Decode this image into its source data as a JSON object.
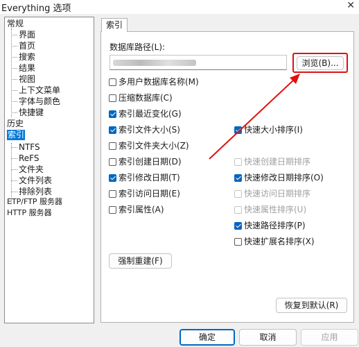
{
  "window": {
    "title": "Everything 选项",
    "close_glyph": "✕"
  },
  "tree": {
    "items": [
      {
        "label": "常规"
      },
      {
        "label": "界面"
      },
      {
        "label": "首页"
      },
      {
        "label": "搜索"
      },
      {
        "label": "结果"
      },
      {
        "label": "视图"
      },
      {
        "label": "上下文菜单"
      },
      {
        "label": "字体与颜色"
      },
      {
        "label": "快捷键"
      },
      {
        "label": "历史"
      },
      {
        "label": "索引",
        "selected": true
      },
      {
        "label": "NTFS"
      },
      {
        "label": "ReFS"
      },
      {
        "label": "文件夹"
      },
      {
        "label": "文件列表"
      },
      {
        "label": "排除列表"
      },
      {
        "label": "ETP/FTP 服务器"
      },
      {
        "label": "HTTP 服务器"
      }
    ]
  },
  "tab": {
    "label": "索引"
  },
  "db_path": {
    "label": "数据库路径(L):",
    "value": "",
    "browse_label": "浏览(B)..."
  },
  "options_left": [
    {
      "label": "多用户数据库名称(M)",
      "checked": false
    },
    {
      "label": "压缩数据库(C)",
      "checked": false
    },
    {
      "label": "索引最近变化(G)",
      "checked": true
    },
    {
      "label": "索引文件大小(S)",
      "checked": true
    },
    {
      "label": "索引文件夹大小(Z)",
      "checked": false
    },
    {
      "label": "索引创建日期(D)",
      "checked": false
    },
    {
      "label": "索引修改日期(T)",
      "checked": true
    },
    {
      "label": "索引访问日期(E)",
      "checked": false
    },
    {
      "label": "索引属性(A)",
      "checked": false
    }
  ],
  "options_right": [
    {
      "label": "快速大小排序(I)",
      "checked": true,
      "disabled": false
    },
    {
      "label": "快速创建日期排序",
      "checked": false,
      "disabled": true
    },
    {
      "label": "快速修改日期排序(O)",
      "checked": true,
      "disabled": false
    },
    {
      "label": "快速访问日期排序",
      "checked": false,
      "disabled": true
    },
    {
      "label": "快速属性排序(U)",
      "checked": false,
      "disabled": true
    },
    {
      "label": "快速路径排序(P)",
      "checked": true,
      "disabled": false
    },
    {
      "label": "快速扩展名排序(X)",
      "checked": false,
      "disabled": false
    }
  ],
  "buttons": {
    "rebuild": "强制重建(F)",
    "restore": "恢复到默认(R)",
    "ok": "确定",
    "cancel": "取消",
    "apply": "应用"
  },
  "colors": {
    "accent": "#0067c0",
    "selection": "#0078d7",
    "annotation": "#e01010"
  }
}
